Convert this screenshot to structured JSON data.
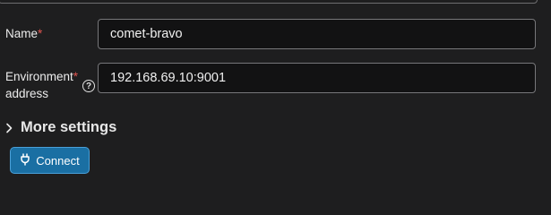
{
  "form": {
    "name": {
      "label": "Name",
      "required_mark": "*",
      "value": "comet-bravo"
    },
    "environment_address": {
      "label_line1": "Environment",
      "label_line2": "address",
      "required_mark": "*",
      "help_icon": "question-circle-icon",
      "help_glyph": "?",
      "value": "192.168.69.10:9001"
    }
  },
  "more_settings": {
    "label": "More settings",
    "icon": "chevron-right-icon"
  },
  "connect_button": {
    "label": "Connect",
    "icon": "plug-icon"
  },
  "colors": {
    "background": "#1e1e1f",
    "input_background": "#121213",
    "required": "#e0554f",
    "primary_button": "#1a6fa3"
  }
}
